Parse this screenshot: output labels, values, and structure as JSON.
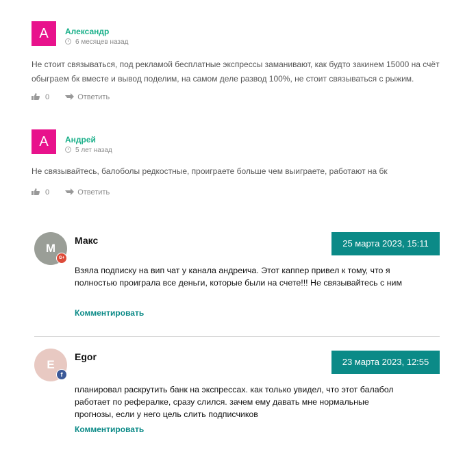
{
  "comments_basic": [
    {
      "avatar_letter": "A",
      "name": "Александр",
      "time": "6 месяцев назад",
      "text": "Не стоит связываться, под рекламой бесплатные экспрессы заманивают, как будто закинем 15000 на счёт обыграем бк вместе и вывод поделим, на самом деле развод 100%, не стоит связываться с рыжим.",
      "likes": "0",
      "reply_label": "Ответить"
    },
    {
      "avatar_letter": "A",
      "name": "Андрей",
      "time": "5 лет назад",
      "text": "Не связывайтесь, балоболы редкостные, проиграете больше чем выиграете, работают на бк",
      "likes": "0",
      "reply_label": "Ответить"
    }
  ],
  "comments_social": [
    {
      "avatar_letter": "M",
      "avatar_color": "#9a9e97",
      "badge": "G+",
      "badge_color": "#dd4b39",
      "name": "Макс",
      "date": "25 марта 2023, 15:11",
      "text": "Взяла подписку на вип чат у канала андреича. Этот каппер привел к тому, что я полностью проиграла все деньги, которые были на счете!!! Не связывайтесь с ним",
      "comment_label": "Комментировать"
    },
    {
      "avatar_letter": "E",
      "avatar_color": "#e8c9c2",
      "badge": "f",
      "badge_color": "#3b5998",
      "name": "Egor",
      "date": "23 марта 2023, 12:55",
      "text": "планировал раскрутить банк на экспрессах. как только увидел, что этот балабол работает по рефералке, сразу слился. зачем ему давать мне нормальные прогнозы, если у него цель слить подписчиков",
      "comment_label": "Комментировать"
    }
  ],
  "colors": {
    "accent_green": "#1bb08a",
    "avatar_pink": "#e8128c",
    "date_teal": "#0b8a87"
  }
}
